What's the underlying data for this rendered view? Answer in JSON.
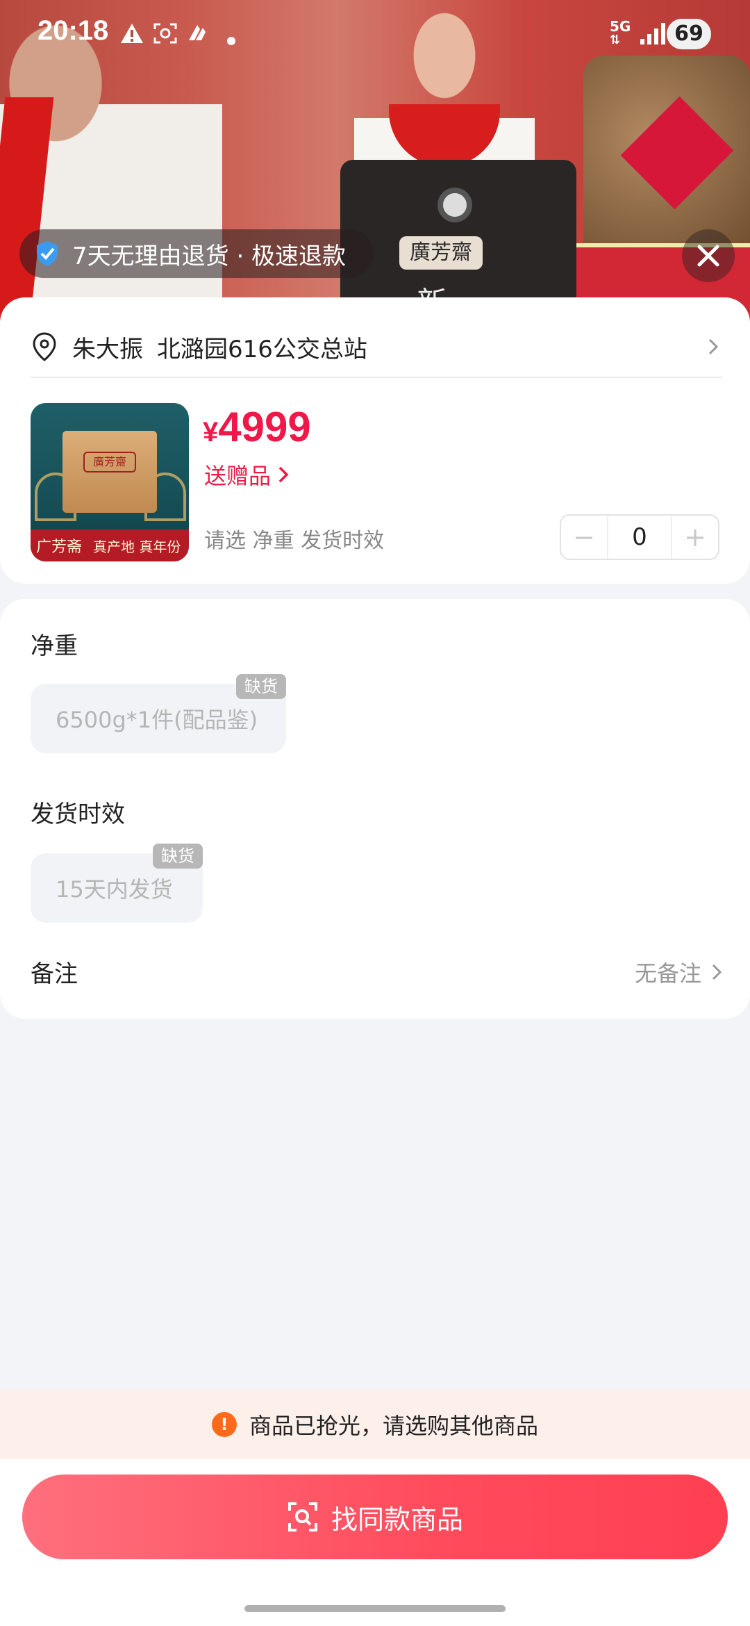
{
  "status_bar": {
    "time": "20:18",
    "network": "5G",
    "battery": "69"
  },
  "hero": {
    "return_policy": "7天无理由退货 · 极速退款",
    "tin_label": "廣芳齋",
    "tin_text": "新"
  },
  "address": {
    "name": "朱大振",
    "location": "北潞园616公交总站"
  },
  "product": {
    "currency": "¥",
    "price": "4999",
    "gift_label": "送赠品",
    "select_hint": "请选 净重 发货时效",
    "quantity": "0",
    "thumb_seal": "廣芳齋",
    "thumb_brand": "广芳斋",
    "thumb_slogan": "真产地 真年份"
  },
  "options": {
    "weight": {
      "title": "净重",
      "items": [
        {
          "label": "6500g*1件(配品鉴)",
          "tag": "缺货"
        }
      ]
    },
    "shipping": {
      "title": "发货时效",
      "items": [
        {
          "label": "15天内发货",
          "tag": "缺货"
        }
      ]
    },
    "remark": {
      "title": "备注",
      "value": "无备注"
    }
  },
  "notice": {
    "text": "商品已抢光，请选购其他商品",
    "icon": "!"
  },
  "cta": {
    "label": "找同款商品"
  },
  "colors": {
    "accent": "#f01848",
    "cta_start": "#ff6f7d",
    "cta_end": "#ff3f52",
    "notice_bg": "#fdf0ea"
  }
}
